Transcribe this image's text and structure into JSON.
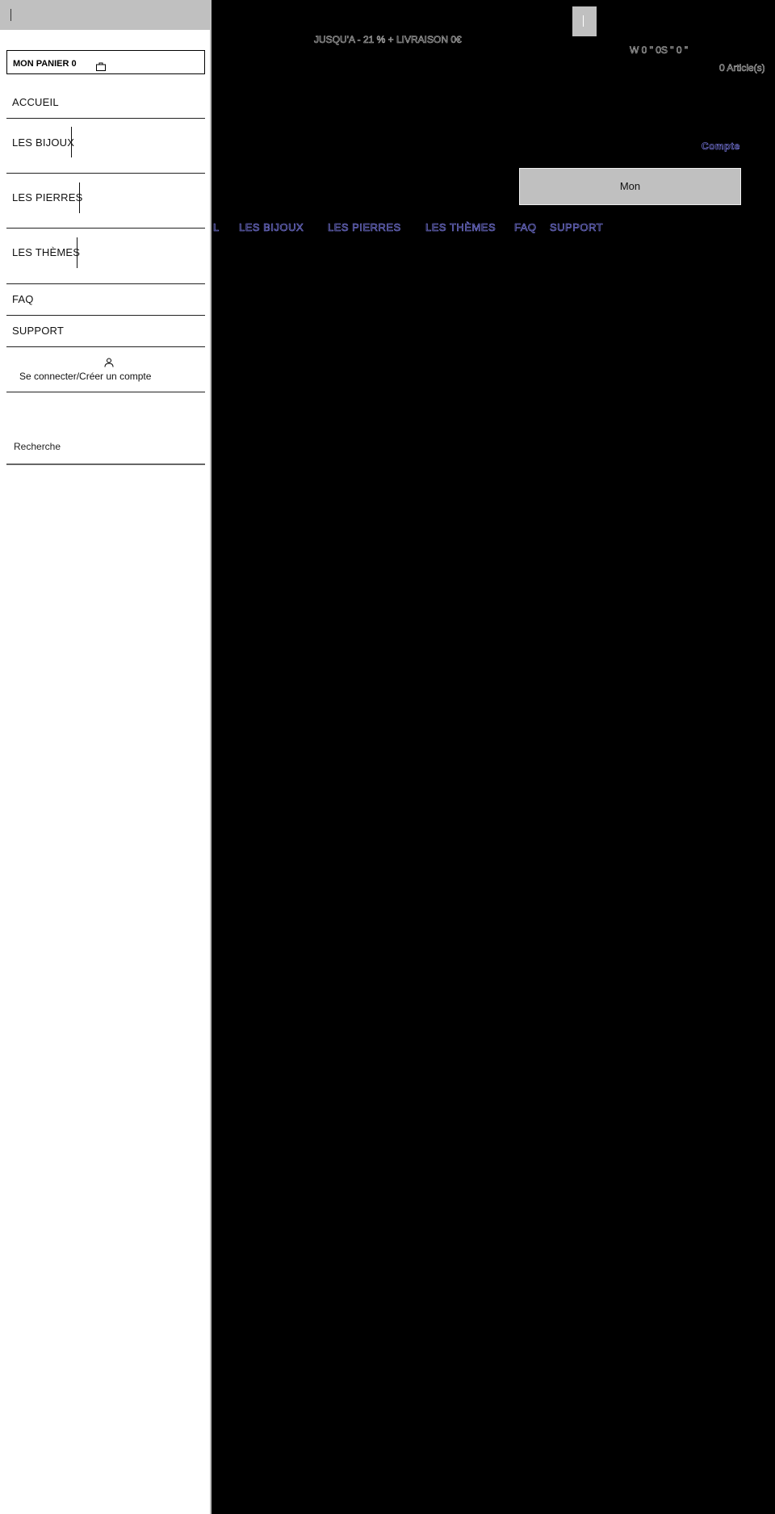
{
  "drawer": {
    "cart_label": "MON PANIER 0",
    "menu": [
      {
        "label": "ACCUEIL"
      },
      {
        "label": "LES BIJOUX"
      },
      {
        "label": "LES PIERRES"
      },
      {
        "label": "LES THÈMES"
      },
      {
        "label": "FAQ"
      },
      {
        "label": "SUPPORT"
      }
    ],
    "account_label": "Se connecter/Créer un compte",
    "search_placeholder": "Recherche"
  },
  "header": {
    "promo": "JUSQU'A - 21 % + LIVRAISON 0€",
    "currency": "W 0 \"  0S \"  0 \"",
    "cart_count": "0 Article(s)",
    "account_link": "Compte",
    "mon_button": "Mon",
    "nav": [
      {
        "label": "L"
      },
      {
        "label": "LES BIJOUX"
      },
      {
        "label": "LES PIERRES"
      },
      {
        "label": "LES THÈMES"
      },
      {
        "label": "FAQ"
      },
      {
        "label": "SUPPORT"
      }
    ]
  },
  "colors": {
    "nav_link": "#8a8aff",
    "drawer_bg": "#ffffff",
    "page_bg": "#000000",
    "button_gray": "#c0c0c0"
  }
}
